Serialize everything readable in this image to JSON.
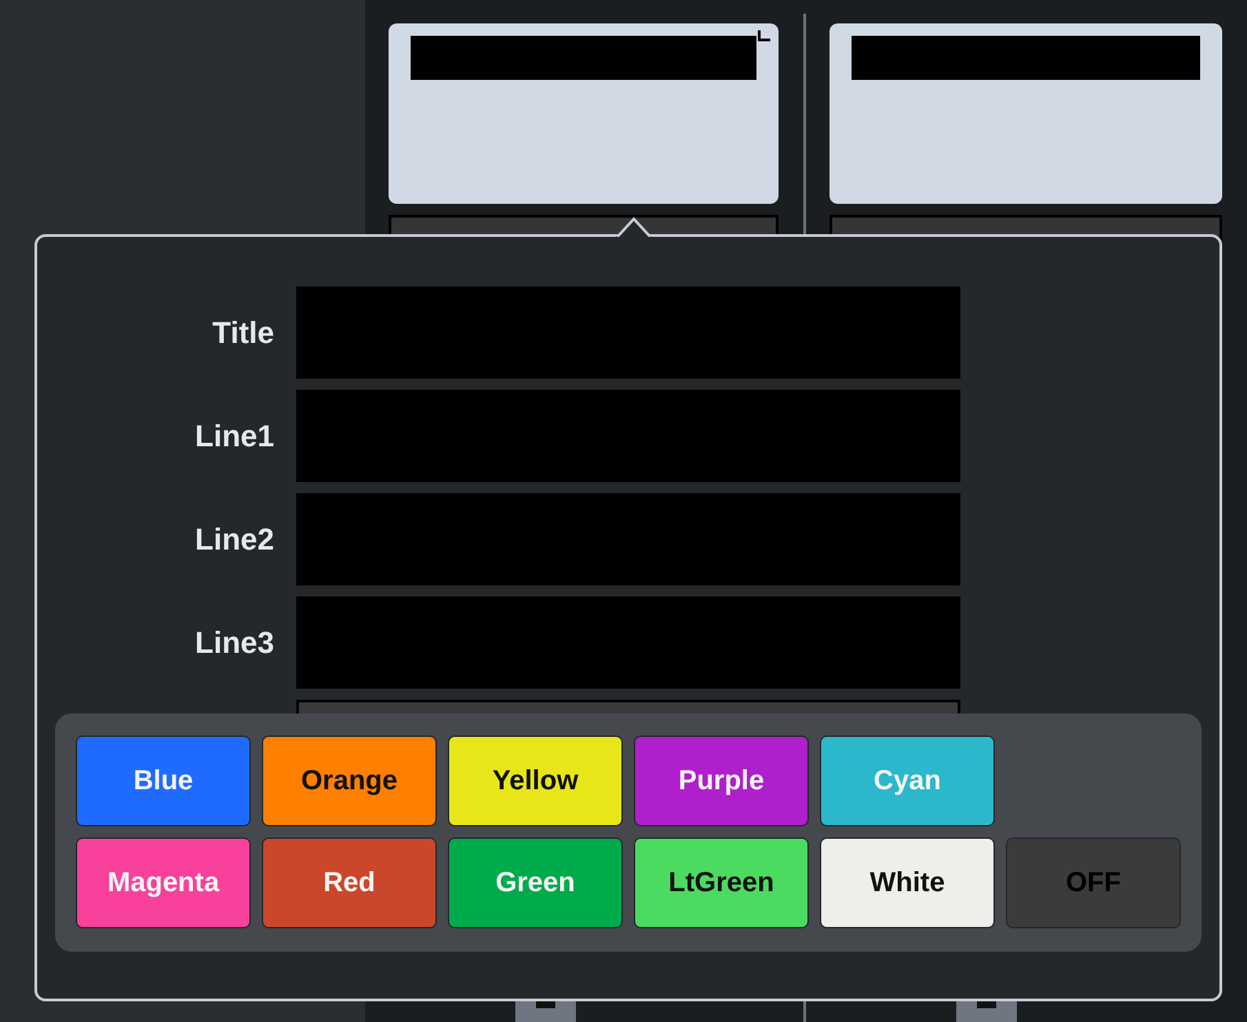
{
  "popover": {
    "fields": [
      {
        "label": "Title"
      },
      {
        "label": "Line1"
      },
      {
        "label": "Line2"
      },
      {
        "label": "Line3"
      }
    ],
    "colors": [
      {
        "label": "Blue",
        "kind": "color",
        "color": "#1f6bff"
      },
      {
        "label": "Orange",
        "kind": "color",
        "color": "#ff7f00"
      },
      {
        "label": "Yellow",
        "kind": "color",
        "color": "#e8e619"
      },
      {
        "label": "Purple",
        "kind": "color",
        "color": "#b01fcc"
      },
      {
        "label": "Cyan",
        "kind": "color",
        "color": "#2bb8cb"
      },
      {
        "label": "Magenta",
        "kind": "color",
        "color": "#f7419a"
      },
      {
        "label": "Red",
        "kind": "color",
        "color": "#cb472b"
      },
      {
        "label": "Green",
        "kind": "color",
        "color": "#00ab4b"
      },
      {
        "label": "LtGreen",
        "kind": "color",
        "color": "#4cdb61"
      },
      {
        "label": "White",
        "kind": "color",
        "color": "#eeeeea"
      },
      {
        "label": "OFF",
        "kind": "off"
      }
    ]
  }
}
